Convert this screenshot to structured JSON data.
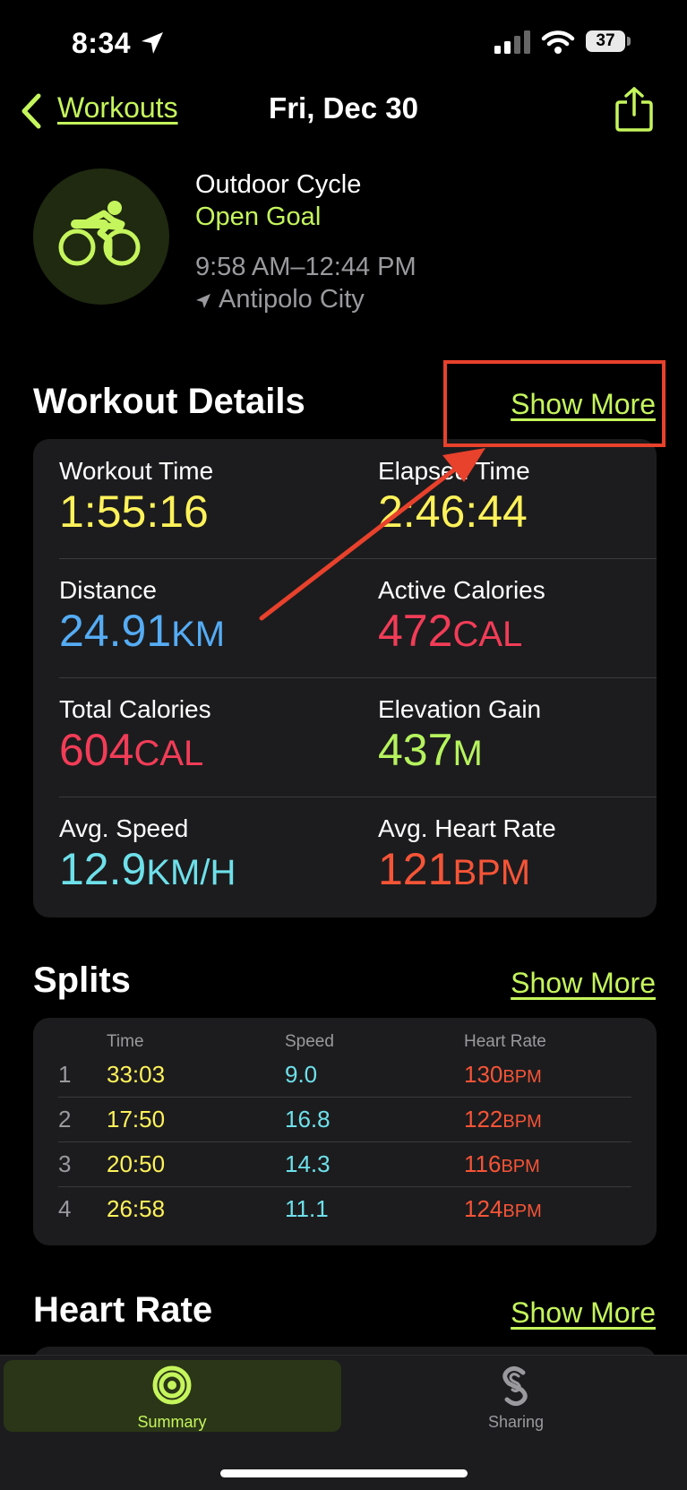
{
  "status_bar": {
    "time": "8:34",
    "battery": "37"
  },
  "nav": {
    "back_label": "Workouts",
    "title": "Fri, Dec 30"
  },
  "workout": {
    "type": "Outdoor Cycle",
    "goal": "Open Goal",
    "time_range": "9:58 AM–12:44 PM",
    "location": "Antipolo City",
    "icon": "cycling-icon"
  },
  "details": {
    "title": "Workout Details",
    "show_more": "Show More",
    "metrics": [
      {
        "label": "Workout Time",
        "value": "1:55:16",
        "unit": "",
        "color": "#fff25a"
      },
      {
        "label": "Elapsed Time",
        "value": "2:46:44",
        "unit": "",
        "color": "#fff25a"
      },
      {
        "label": "Distance",
        "value": "24.91",
        "unit": "km",
        "color": "#55acf4"
      },
      {
        "label": "Active Calories",
        "value": "472",
        "unit": "cal",
        "color": "#f23c57"
      },
      {
        "label": "Total Calories",
        "value": "604",
        "unit": "cal",
        "color": "#f23c57"
      },
      {
        "label": "Elevation Gain",
        "value": "437",
        "unit": "m",
        "color": "#b6f35e"
      },
      {
        "label": "Avg. Speed",
        "value": "12.9",
        "unit": "km/h",
        "color": "#6ee0ea"
      },
      {
        "label": "Avg. Heart Rate",
        "value": "121",
        "unit": "bpm",
        "color": "#f65437"
      }
    ]
  },
  "splits": {
    "title": "Splits",
    "show_more": "Show More",
    "columns": [
      "Time",
      "Speed",
      "Heart Rate"
    ],
    "rows": [
      {
        "index": "1",
        "time": "33:03",
        "speed": "9.0",
        "hr": "130",
        "hr_unit": "bpm"
      },
      {
        "index": "2",
        "time": "17:50",
        "speed": "16.8",
        "hr": "122",
        "hr_unit": "bpm"
      },
      {
        "index": "3",
        "time": "20:50",
        "speed": "14.3",
        "hr": "116",
        "hr_unit": "bpm"
      },
      {
        "index": "4",
        "time": "26:58",
        "speed": "11.1",
        "hr": "124",
        "hr_unit": "bpm"
      }
    ]
  },
  "heart_rate": {
    "title": "Heart Rate",
    "show_more": "Show More"
  },
  "tabs": [
    {
      "label": "Summary",
      "icon": "activity-rings-icon",
      "selected": true
    },
    {
      "label": "Sharing",
      "icon": "sharing-icon",
      "selected": false
    }
  ],
  "annotation": {
    "highlight_color": "#e8412c"
  }
}
